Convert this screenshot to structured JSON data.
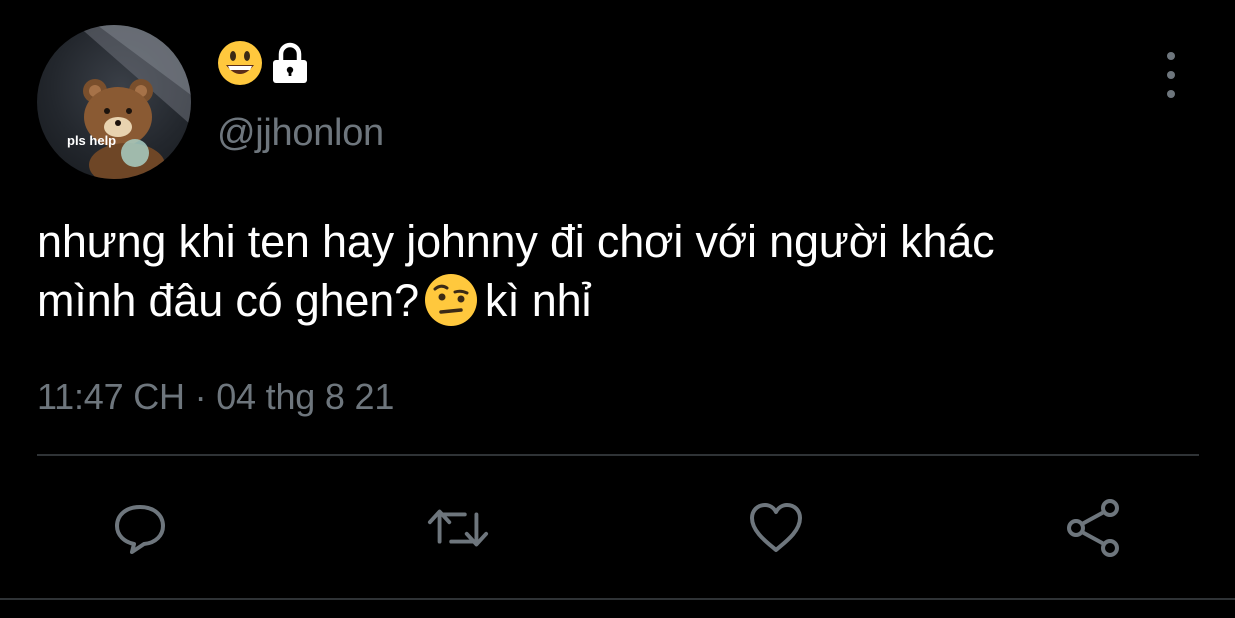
{
  "user": {
    "avatar_caption": "pls help",
    "name_emoji": "grinning-face-emoji",
    "lock_icon": "lock-icon",
    "handle": "@jjhonlon"
  },
  "tweet": {
    "line1": "nhưng khi ten hay johnny đi chơi với người khác",
    "line2_before": "mình đâu có ghen?",
    "line2_emoji": "face-with-raised-eyebrow-emoji",
    "line2_after": "kì nhỉ"
  },
  "meta": {
    "timestamp": "11:47 CH · 04 thg 8 21"
  },
  "actions": [
    {
      "icon": "reply-icon"
    },
    {
      "icon": "retweet-icon"
    },
    {
      "icon": "like-icon"
    },
    {
      "icon": "share-icon"
    }
  ],
  "colors": {
    "background": "#000000",
    "text": "#ffffff",
    "secondary": "#6e767d",
    "divider": "#2f3336",
    "emoji_yellow": "#ffc83d"
  }
}
